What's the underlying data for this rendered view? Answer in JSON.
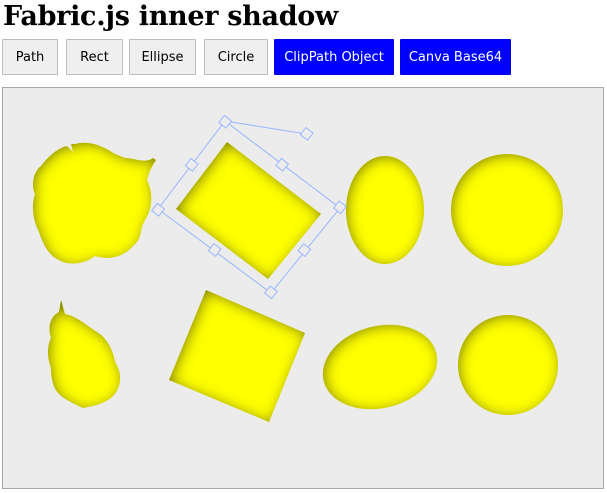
{
  "page": {
    "title": "Fabric.js inner shadow"
  },
  "toolbar": {
    "buttons": [
      {
        "label": "Path"
      },
      {
        "label": "Rect"
      },
      {
        "label": "Ellipse"
      },
      {
        "label": "Circle"
      },
      {
        "label": "ClipPath Object"
      },
      {
        "label": "Canva Base64"
      }
    ]
  },
  "canvas": {
    "fill_color": "#ffff00",
    "shadow_color": "#6b6b00",
    "background": "#ececec",
    "selection_color": "#9bb6ff",
    "selected_object": "rect"
  }
}
